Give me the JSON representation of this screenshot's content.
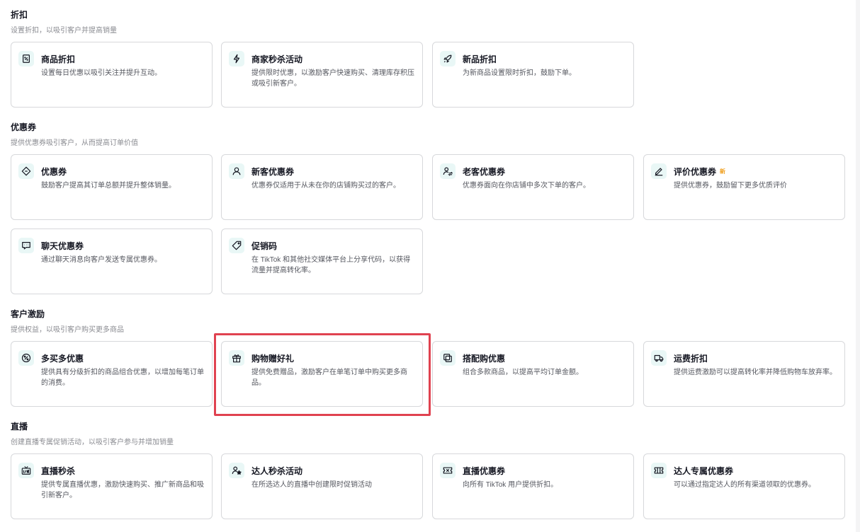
{
  "sections": [
    {
      "title": "折扣",
      "subtitle": "设置折扣，以吸引客户并提高销量",
      "cards": [
        {
          "title": "商品折扣",
          "desc": "设置每日优惠以吸引关注并提升互动。",
          "icon": "discount-tag-icon"
        },
        {
          "title": "商家秒杀活动",
          "desc": "提供限时优惠，以激励客户快速购买、清理库存积压或吸引新客户。",
          "icon": "lightning-icon"
        },
        {
          "title": "新品折扣",
          "desc": "为新商品设置限时折扣，鼓励下单。",
          "icon": "rocket-icon"
        }
      ]
    },
    {
      "title": "优惠券",
      "subtitle": "提供优惠券吸引客户，从而提高订单价值",
      "cards": [
        {
          "title": "优惠券",
          "desc": "鼓励客户提高其订单总额并提升整体销量。",
          "icon": "coupon-icon"
        },
        {
          "title": "新客优惠券",
          "desc": "优惠券仅适用于从未在你的店铺购买过的客户。",
          "icon": "user-icon"
        },
        {
          "title": "老客优惠券",
          "desc": "优惠券面向在你店铺中多次下单的客户。",
          "icon": "returning-user-icon"
        },
        {
          "title": "评价优惠券",
          "badge": "新",
          "desc": "提供优惠券，鼓励留下更多优质评价",
          "icon": "pen-icon"
        },
        {
          "title": "聊天优惠券",
          "desc": "通过聊天消息向客户发送专属优惠券。",
          "icon": "chat-icon"
        },
        {
          "title": "促销码",
          "desc": "在 TikTok 和其他社交媒体平台上分享代码，以获得流量并提高转化率。",
          "icon": "promo-tag-icon"
        }
      ]
    },
    {
      "title": "客户激励",
      "subtitle": "提供权益，以吸引客户购买更多商品",
      "cards": [
        {
          "title": "多买多优惠",
          "desc": "提供具有分级折扣的商品组合优惠，以增加每笔订单的消费。",
          "icon": "percent-icon"
        },
        {
          "title": "购物赠好礼",
          "desc": "提供免费赠品，激励客户在单笔订单中购买更多商品。",
          "icon": "gift-icon"
        },
        {
          "title": "搭配购优惠",
          "desc": "组合多款商品，以提高平均订单金额。",
          "icon": "bundle-icon"
        },
        {
          "title": "运费折扣",
          "desc": "提供运费激励可以提高转化率并降低购物车放弃率。",
          "icon": "delivery-truck-icon"
        }
      ]
    },
    {
      "title": "直播",
      "subtitle": "创建直播专属促销活动，以吸引客户参与并增加销量",
      "cards": [
        {
          "title": "直播秒杀",
          "desc": "提供专属直播优惠，激励快速购买、推广新商品和吸引新客户。",
          "icon": "live-tv-icon"
        },
        {
          "title": "达人秒杀活动",
          "desc": "在所选达人的直播中创建限时促销活动",
          "icon": "creator-star-icon"
        },
        {
          "title": "直播优惠券",
          "desc": "向所有 TikTok 用户提供折扣。",
          "icon": "live-coupon-icon"
        },
        {
          "title": "达人专属优惠券",
          "desc": "可以通过指定达人的所有渠道领取的优惠券。",
          "icon": "ticket-icon"
        }
      ]
    }
  ],
  "colors": {
    "icon_bg": "#e9f7f6",
    "icon_stroke": "#161823",
    "highlight": "#e04250",
    "new_badge": "#f0a020"
  }
}
